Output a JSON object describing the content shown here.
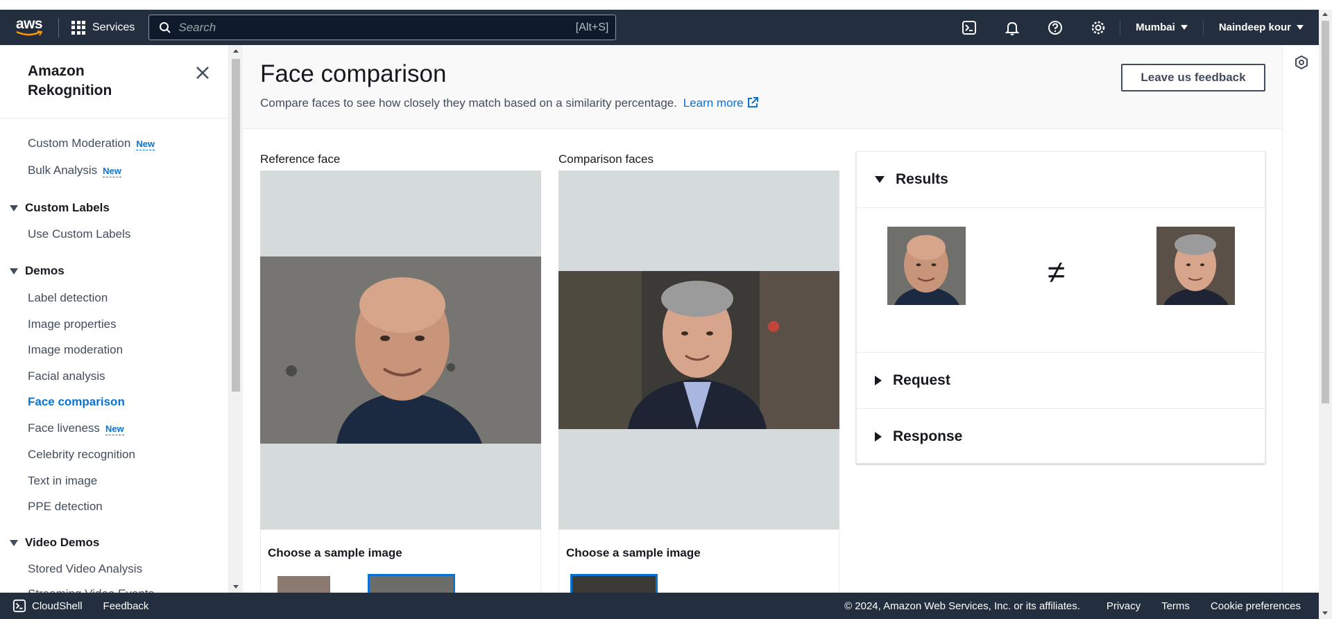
{
  "topnav": {
    "logo_text": "aws",
    "services_label": "Services",
    "search_placeholder": "Search",
    "search_shortcut": "[Alt+S]",
    "region": "Mumbai",
    "account": "Naindeep kour"
  },
  "sidebar": {
    "title": "Amazon Rekognition",
    "items_top": [
      {
        "label": "Custom Moderation",
        "badge": "New"
      },
      {
        "label": "Bulk Analysis",
        "badge": "New"
      }
    ],
    "section_custom_labels": "Custom Labels",
    "custom_labels_items": [
      {
        "label": "Use Custom Labels"
      }
    ],
    "section_demos": "Demos",
    "demo_items": [
      {
        "label": "Label detection"
      },
      {
        "label": "Image properties"
      },
      {
        "label": "Image moderation"
      },
      {
        "label": "Facial analysis"
      },
      {
        "label": "Face comparison",
        "active": true
      },
      {
        "label": "Face liveness",
        "badge": "New"
      },
      {
        "label": "Celebrity recognition"
      },
      {
        "label": "Text in image"
      },
      {
        "label": "PPE detection"
      }
    ],
    "section_video_demos": "Video Demos",
    "video_items": [
      {
        "label": "Stored Video Analysis"
      },
      {
        "label": "Streaming Video Events"
      }
    ]
  },
  "page": {
    "title": "Face comparison",
    "subtitle": "Compare faces to see how closely they match based on a similarity percentage.",
    "learn_more": "Learn more",
    "feedback_button": "Leave us feedback"
  },
  "reference": {
    "label": "Reference face",
    "sample_title": "Choose a sample image"
  },
  "comparison": {
    "label": "Comparison faces",
    "sample_title": "Choose a sample image"
  },
  "results": {
    "results_label": "Results",
    "match_symbol": "≠",
    "request_label": "Request",
    "response_label": "Response"
  },
  "footer": {
    "cloudshell": "CloudShell",
    "feedback": "Feedback",
    "copyright": "© 2024, Amazon Web Services, Inc. or its affiliates.",
    "privacy": "Privacy",
    "terms": "Terms",
    "cookie": "Cookie preferences"
  },
  "colors": {
    "nav_bg": "#232f3e",
    "link_blue": "#0972d3",
    "image_bg": "#d5dbdb",
    "header_bg": "#f9f9fa"
  }
}
